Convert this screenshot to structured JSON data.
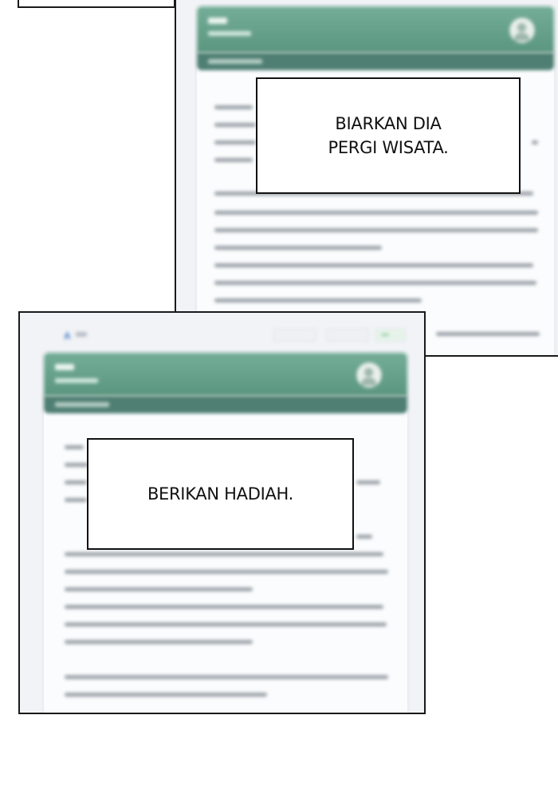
{
  "captions": {
    "top": "BIARKAN DIA\nPERGI WISATA.",
    "bottom": "BERIKAN HADIAH."
  },
  "app": {
    "logo_glyph": "A"
  },
  "icons": {
    "avatar": "user-avatar-icon"
  },
  "colors": {
    "header_green": "#6aa790",
    "header_dark": "#4f7f72",
    "panel_bg": "#f1f3f6",
    "border": "#1a1a1a"
  }
}
